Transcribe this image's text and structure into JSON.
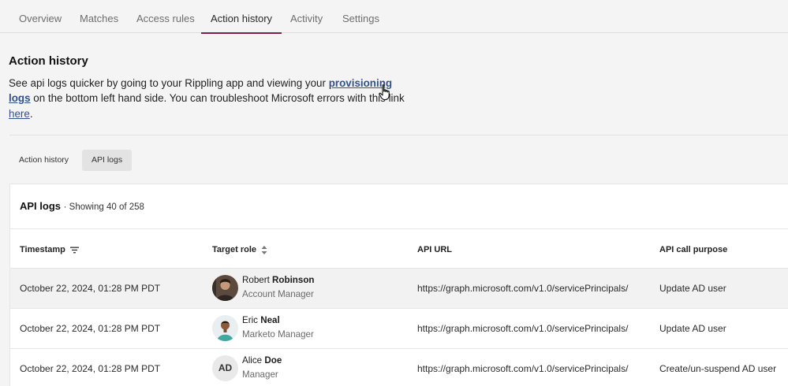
{
  "top_tabs": [
    {
      "label": "Overview"
    },
    {
      "label": "Matches"
    },
    {
      "label": "Access rules"
    },
    {
      "label": "Action history",
      "active": true
    },
    {
      "label": "Activity"
    },
    {
      "label": "Settings"
    }
  ],
  "page": {
    "title": "Action history",
    "desc_part1": "See api logs quicker by going to your Rippling app and viewing your ",
    "provisioning_link": "provisioning logs",
    "desc_part2": " on the bottom left hand side. You can troubleshoot Microsoft errors with this link ",
    "here_link": "here",
    "desc_end": "."
  },
  "sub_tabs": [
    {
      "label": "Action history"
    },
    {
      "label": "API logs",
      "active": true
    }
  ],
  "card": {
    "title": "API logs",
    "count": "· Showing 40 of 258"
  },
  "columns": {
    "timestamp": "Timestamp",
    "target_role": "Target role",
    "api_url": "API URL",
    "purpose": "API call purpose"
  },
  "rows": [
    {
      "timestamp": "October 22, 2024, 01:28 PM PDT",
      "first_name": "Robert",
      "last_name": "Robinson",
      "role": "Account Manager",
      "url": "https://graph.microsoft.com/v1.0/servicePrincipals/",
      "purpose": "Update AD user"
    },
    {
      "timestamp": "October 22, 2024, 01:28 PM PDT",
      "first_name": "Eric",
      "last_name": "Neal",
      "role": "Marketo Manager",
      "url": "https://graph.microsoft.com/v1.0/servicePrincipals/",
      "purpose": "Update AD user"
    },
    {
      "timestamp": "October 22, 2024, 01:28 PM PDT",
      "first_name": "Alice",
      "last_name": "Doe",
      "initials": "AD",
      "role": "Manager",
      "url": "https://graph.microsoft.com/v1.0/servicePrincipals/",
      "purpose": "Create/un-suspend AD user"
    }
  ],
  "colors": {
    "accent": "#7a2048",
    "link": "#33508a"
  },
  "icons": {
    "sort_timestamp": "filter-lines-icon",
    "sort_role": "sort-updown-icon",
    "cursor": "hand-pointer-icon"
  }
}
